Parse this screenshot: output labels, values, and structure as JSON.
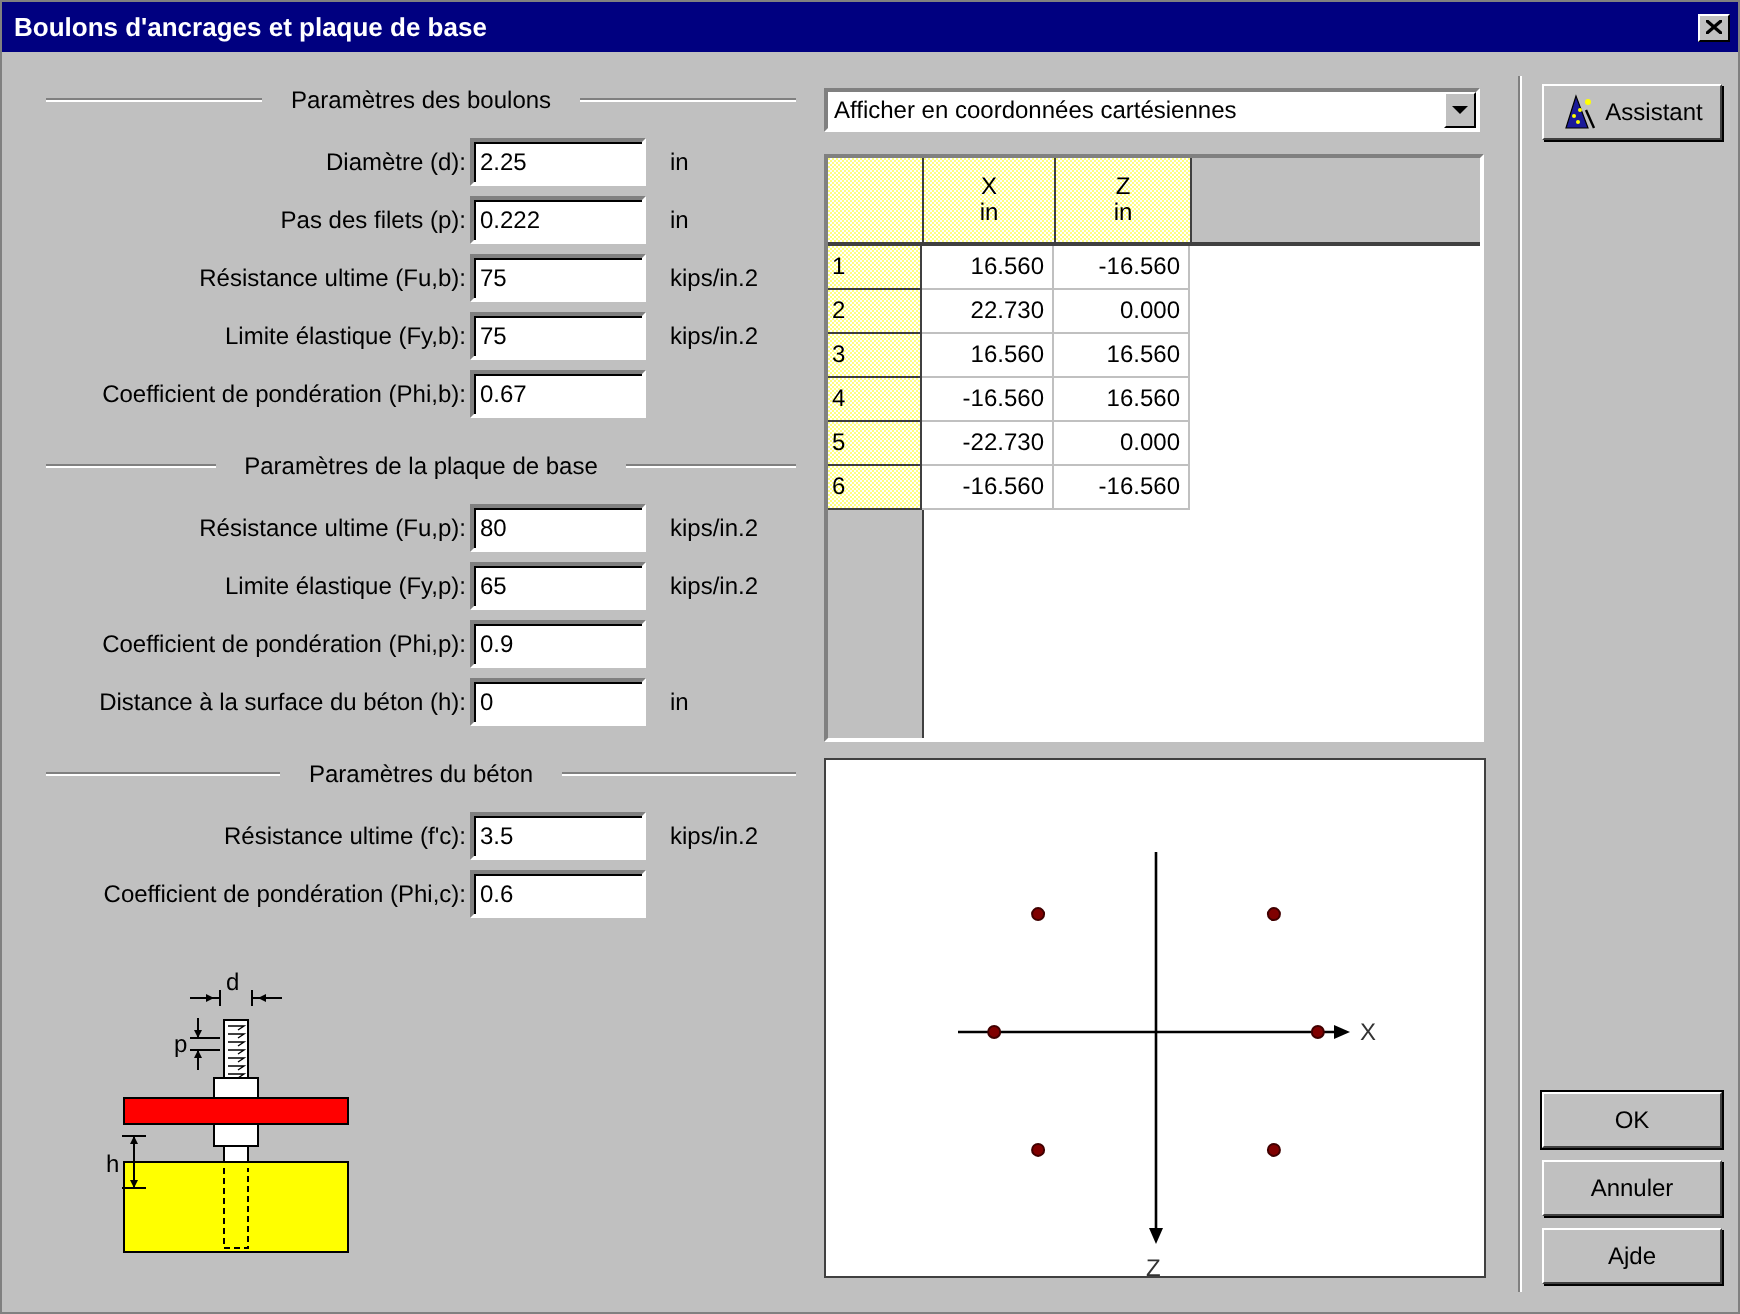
{
  "window": {
    "title": "Boulons d'ancrages et plaque de base"
  },
  "sections": [
    {
      "title": "Paramètres des boulons",
      "fields": [
        {
          "label": "Diamètre (d):",
          "value": "2.25",
          "unit": "in"
        },
        {
          "label": "Pas des filets (p):",
          "value": "0.222",
          "unit": "in"
        },
        {
          "label": "Résistance ultime (Fu,b):",
          "value": "75",
          "unit": "kips/in.2"
        },
        {
          "label": "Limite élastique (Fy,b):",
          "value": "75",
          "unit": "kips/in.2"
        },
        {
          "label": "Coefficient de pondération (Phi,b):",
          "value": "0.67"
        }
      ]
    },
    {
      "title": "Paramètres de la plaque de base",
      "fields": [
        {
          "label": "Résistance ultime (Fu,p):",
          "value": "80",
          "unit": "kips/in.2"
        },
        {
          "label": "Limite élastique (Fy,p):",
          "value": "65",
          "unit": "kips/in.2"
        },
        {
          "label": "Coefficient de pondération (Phi,p):",
          "value": "0.9"
        },
        {
          "label": "Distance à la surface du béton (h):",
          "value": "0",
          "unit": "in"
        }
      ]
    },
    {
      "title": "Paramètres du béton",
      "fields": [
        {
          "label": "Résistance ultime (f'c):",
          "value": "3.5",
          "unit": "kips/in.2"
        },
        {
          "label": "Coefficient de pondération (Phi,c):",
          "value": "0.6"
        }
      ]
    }
  ],
  "diagram": {
    "labels": [
      "d",
      "p",
      "h"
    ]
  },
  "view_select": {
    "value": "Afficher en coordonnées cartésiennes"
  },
  "table": {
    "columns": [
      {
        "name": "X",
        "unit": "in"
      },
      {
        "name": "Z",
        "unit": "in"
      }
    ],
    "rows": [
      {
        "index": "1",
        "cells": [
          "16.560",
          "-16.560"
        ]
      },
      {
        "index": "2",
        "cells": [
          "22.730",
          "0.000"
        ]
      },
      {
        "index": "3",
        "cells": [
          "16.560",
          "16.560"
        ]
      },
      {
        "index": "4",
        "cells": [
          "-16.560",
          "16.560"
        ]
      },
      {
        "index": "5",
        "cells": [
          "-22.730",
          "0.000"
        ]
      },
      {
        "index": "6",
        "cells": [
          "-16.560",
          "-16.560"
        ]
      }
    ]
  },
  "plot": {
    "x_axis": "X",
    "z_axis": "Z"
  },
  "buttons": {
    "assistant": "Assistant",
    "ok": "OK",
    "cancel": "Annuler",
    "help": "Ajde"
  }
}
